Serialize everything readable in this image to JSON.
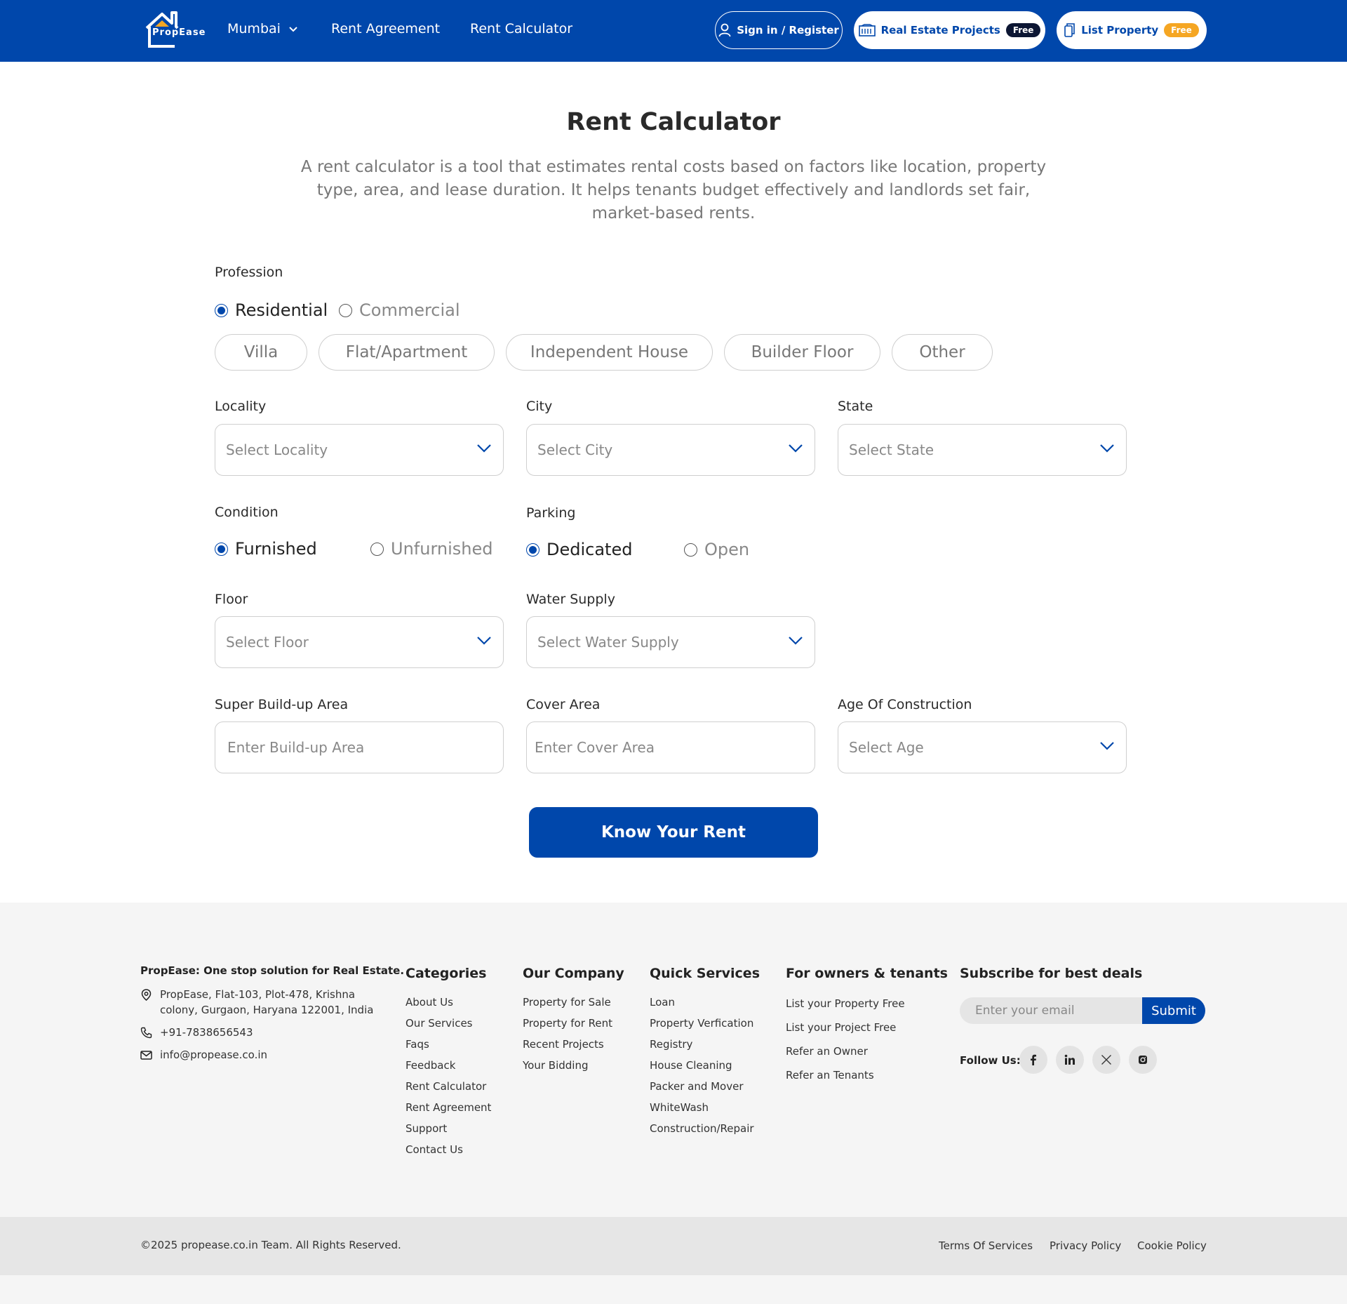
{
  "header": {
    "logo_text": "PropEase",
    "city": "Mumbai",
    "nav": {
      "rent_agreement": "Rent Agreement",
      "rent_calculator": "Rent Calculator"
    },
    "sign_in": "Sign in / Register",
    "projects": {
      "label": "Real Estate Projects",
      "badge": "Free"
    },
    "list_property": {
      "label": "List Property",
      "badge": "Free"
    }
  },
  "main": {
    "title": "Rent Calculator",
    "description": "A rent calculator is a tool that estimates rental costs based on factors like location, property type, area, and lease duration. It helps tenants budget effectively and landlords set fair, market-based rents.",
    "profession": {
      "label": "Profession",
      "options": [
        "Residential",
        "Commercial"
      ],
      "selected": "Residential",
      "types": [
        "Villa",
        "Flat/Apartment",
        "Independent House",
        "Builder Floor",
        "Other"
      ]
    },
    "locality": {
      "label": "Locality",
      "placeholder": "Select Locality"
    },
    "city": {
      "label": "City",
      "placeholder": "Select City"
    },
    "state": {
      "label": "State",
      "placeholder": "Select State"
    },
    "condition": {
      "label": "Condition",
      "options": [
        "Furnished",
        "Unfurnished"
      ],
      "selected": "Furnished"
    },
    "parking": {
      "label": "Parking",
      "options": [
        "Dedicated",
        "Open"
      ],
      "selected": "Dedicated"
    },
    "floor": {
      "label": "Floor",
      "placeholder": "Select Floor"
    },
    "water_supply": {
      "label": "Water Supply",
      "placeholder": "Select Water Supply"
    },
    "super_buildup": {
      "label": "Super Build-up Area",
      "placeholder": "Enter Build-up Area"
    },
    "cover_area": {
      "label": "Cover Area",
      "placeholder": "Enter Cover Area"
    },
    "age": {
      "label": "Age Of Construction",
      "placeholder": "Select Age"
    },
    "submit": "Know Your Rent"
  },
  "footer": {
    "tagline": "PropEase: One stop solution for Real Estate.",
    "address": "PropEase, Flat-103, Plot-478, Krishna colony, Gurgaon, Haryana 122001, India",
    "phone": "+91-7838656543",
    "email": "info@propease.co.in",
    "categories": {
      "title": "Categories",
      "links": [
        "About Us",
        "Our Services",
        "Faqs",
        "Feedback",
        "Rent Calculator",
        "Rent Agreement",
        "Support",
        "Contact Us"
      ]
    },
    "company": {
      "title": "Our Company",
      "links": [
        "Property for Sale",
        "Property for Rent",
        "Recent Projects",
        "Your Bidding"
      ]
    },
    "quick": {
      "title": "Quick Services",
      "links": [
        "Loan",
        "Property Verfication",
        "Registry",
        "House Cleaning",
        "Packer and Mover",
        "WhiteWash",
        "Construction/Repair"
      ]
    },
    "owners": {
      "title": "For owners & tenants",
      "links": [
        "List your Property Free",
        "List your Project Free",
        "Refer an Owner",
        "Refer an Tenants"
      ]
    },
    "subscribe": {
      "title": "Subscribe for best deals",
      "placeholder": "Enter your email",
      "button": "Submit",
      "follow": "Follow Us:"
    },
    "social_icons": [
      "facebook-icon",
      "linkedin-icon",
      "x-icon",
      "instagram-icon"
    ],
    "copyright": "©2025 propease.co.in Team. All Rights Reserved.",
    "legal": [
      "Terms Of Services",
      "Privacy Policy",
      "Cookie Policy"
    ]
  },
  "colors": {
    "brand": "#0047ab",
    "badge_dark": "#0c1633",
    "badge_orange": "#f5a623"
  }
}
